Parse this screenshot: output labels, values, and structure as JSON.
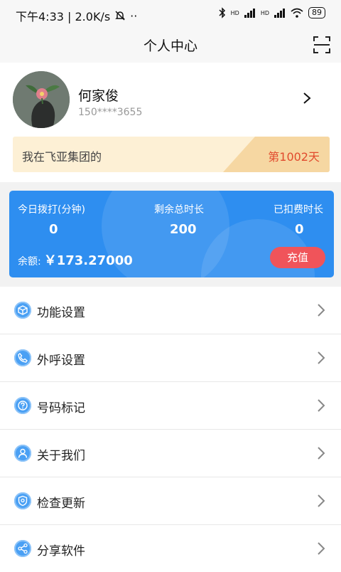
{
  "status_bar": {
    "time_speed": "下午4:33 | 2.0K/s",
    "more": "··",
    "network_badge": "HD",
    "battery": "89"
  },
  "header": {
    "title": "个人中心"
  },
  "profile": {
    "name": "何家俊",
    "phone": "150****3655",
    "banner": {
      "text": "我在飞亚集团的",
      "days": "第1002天"
    }
  },
  "stats": {
    "items": [
      {
        "label": "今日拨打(分钟)",
        "value": "0"
      },
      {
        "label": "剩余总时长",
        "value": "200"
      },
      {
        "label": "已扣费时长",
        "value": "0"
      }
    ],
    "balance_label": "余额:",
    "balance_value": "￥173.27000",
    "recharge_label": "充值"
  },
  "menu": {
    "items": [
      {
        "label": "功能设置",
        "icon": "cube-icon"
      },
      {
        "label": "外呼设置",
        "icon": "phone-icon"
      },
      {
        "label": "号码标记",
        "icon": "question-icon"
      },
      {
        "label": "关于我们",
        "icon": "person-icon"
      },
      {
        "label": "检查更新",
        "icon": "shield-icon"
      },
      {
        "label": "分享软件",
        "icon": "share-icon"
      }
    ]
  },
  "colors": {
    "card_blue": "#2e8ef0",
    "recharge_red": "#f0545a",
    "banner_days": "#e14a2d",
    "icon_blue": "#4aa0f4"
  }
}
